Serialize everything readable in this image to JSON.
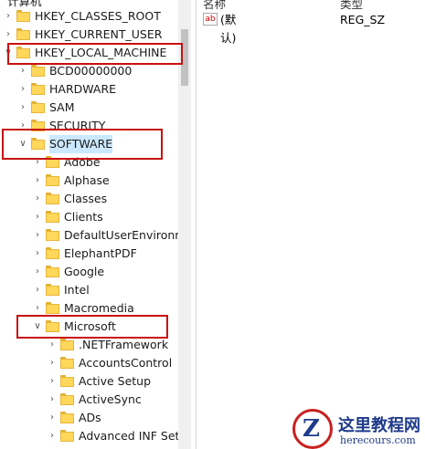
{
  "tree": {
    "top_item": "计算机",
    "items": [
      {
        "label": "HKEY_CLASSES_ROOT",
        "level": 0,
        "expanded": false
      },
      {
        "label": "HKEY_CURRENT_USER",
        "level": 0,
        "expanded": false
      },
      {
        "label": "HKEY_LOCAL_MACHINE",
        "level": 0,
        "expanded": true
      },
      {
        "label": "BCD00000000",
        "level": 1,
        "expanded": false
      },
      {
        "label": "HARDWARE",
        "level": 1,
        "expanded": false
      },
      {
        "label": "SAM",
        "level": 1,
        "expanded": false
      },
      {
        "label": "SECURITY",
        "level": 1,
        "expanded": false
      },
      {
        "label": "SOFTWARE",
        "level": 1,
        "expanded": true
      },
      {
        "label": "Adobe",
        "level": 2,
        "expanded": false
      },
      {
        "label": "Alphase",
        "level": 2,
        "expanded": false
      },
      {
        "label": "Classes",
        "level": 2,
        "expanded": false
      },
      {
        "label": "Clients",
        "level": 2,
        "expanded": false
      },
      {
        "label": "DefaultUserEnvironment",
        "level": 2,
        "expanded": false
      },
      {
        "label": "ElephantPDF",
        "level": 2,
        "expanded": false
      },
      {
        "label": "Google",
        "level": 2,
        "expanded": false
      },
      {
        "label": "Intel",
        "level": 2,
        "expanded": false
      },
      {
        "label": "Macromedia",
        "level": 2,
        "expanded": false
      },
      {
        "label": "Microsoft",
        "level": 2,
        "expanded": true
      },
      {
        "label": ".NETFramework",
        "level": 3,
        "expanded": false
      },
      {
        "label": "AccountsControl",
        "level": 3,
        "expanded": false
      },
      {
        "label": "Active Setup",
        "level": 3,
        "expanded": false
      },
      {
        "label": "ActiveSync",
        "level": 3,
        "expanded": false
      },
      {
        "label": "ADs",
        "level": 3,
        "expanded": false
      },
      {
        "label": "Advanced INF Setup",
        "level": 3,
        "expanded": false
      }
    ]
  },
  "list": {
    "col_name": "名称",
    "col_type": "类型",
    "value_name": "(默认)",
    "value_type": "REG_SZ",
    "value_icon": "ab-string-icon"
  },
  "watermark": {
    "title": "这里教程网",
    "url": "herecours.com"
  },
  "colors": {
    "highlight": "#c81010",
    "folder": "#ffd75a"
  }
}
